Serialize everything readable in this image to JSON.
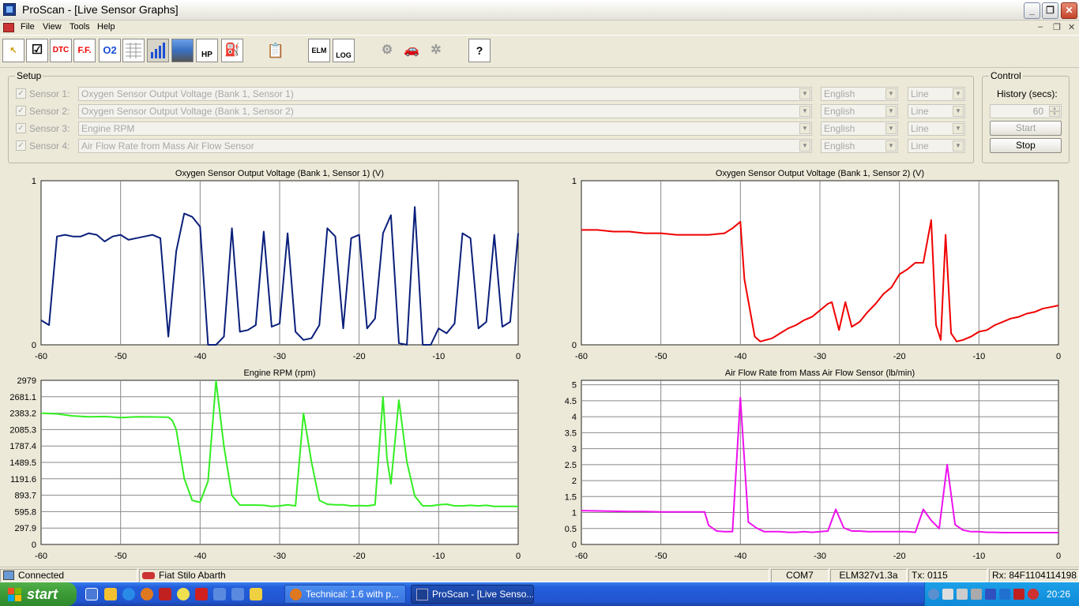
{
  "window": {
    "title": "ProScan - [Live Sensor Graphs]"
  },
  "menu": [
    "File",
    "View",
    "Tools",
    "Help"
  ],
  "toolbar": {
    "buttons": [
      "cursor",
      "checklist",
      "DTC",
      "F.F.",
      "O2",
      "table",
      "bar-graph",
      "road",
      "HP",
      "fuel",
      "clipboard",
      "ELM",
      "LOG",
      "engine",
      "car",
      "gear",
      "help"
    ],
    "labels": {
      "dtc": "DTC",
      "ff": "F.F.",
      "o2": "O2",
      "hp": "HP",
      "elm": "ELM",
      "log": "LOG",
      "help": "?"
    }
  },
  "setup": {
    "title": "Setup",
    "sensors": [
      {
        "label": "Sensor 1:",
        "pid": "Oxygen Sensor Output Voltage (Bank 1, Sensor 1)",
        "units": "English",
        "style": "Line"
      },
      {
        "label": "Sensor 2:",
        "pid": "Oxygen Sensor Output Voltage (Bank 1, Sensor 2)",
        "units": "English",
        "style": "Line"
      },
      {
        "label": "Sensor 3:",
        "pid": "Engine RPM",
        "units": "English",
        "style": "Line"
      },
      {
        "label": "Sensor 4:",
        "pid": "Air Flow Rate from Mass Air Flow Sensor",
        "units": "English",
        "style": "Line"
      }
    ]
  },
  "control": {
    "title": "Control",
    "history_label": "History (secs):",
    "history_value": "60",
    "start_label": "Start",
    "stop_label": "Stop"
  },
  "chart_data": [
    {
      "type": "line",
      "title": "Oxygen Sensor Output Voltage (Bank 1, Sensor 1) (V)",
      "color": "#0a1f7a",
      "x_ticks": [
        "-60",
        "-50",
        "-40",
        "-30",
        "-20",
        "-10",
        "0"
      ],
      "y_ticks": [
        "1",
        "0"
      ],
      "xlim": [
        -60,
        0
      ],
      "ylim": [
        0,
        1
      ],
      "x": [
        -60,
        -59,
        -58,
        -57,
        -56,
        -55,
        -54,
        -53,
        -52,
        -51,
        -50,
        -49,
        -48,
        -47,
        -46,
        -45,
        -44,
        -43,
        -42,
        -41,
        -40,
        -39,
        -38,
        -37,
        -36,
        -35,
        -34,
        -33,
        -32,
        -31,
        -30,
        -29,
        -28,
        -27,
        -26,
        -25,
        -24,
        -23,
        -22,
        -21,
        -20,
        -19,
        -18,
        -17,
        -16,
        -15,
        -14,
        -13,
        -12,
        -11,
        -10,
        -9,
        -8,
        -7,
        -6,
        -5,
        -4,
        -3,
        -2,
        -1,
        0
      ],
      "y": [
        0.15,
        0.12,
        0.66,
        0.67,
        0.66,
        0.66,
        0.68,
        0.67,
        0.63,
        0.66,
        0.67,
        0.64,
        0.65,
        0.66,
        0.67,
        0.65,
        0.05,
        0.57,
        0.8,
        0.78,
        0.72,
        0.0,
        0.0,
        0.05,
        0.71,
        0.08,
        0.09,
        0.12,
        0.69,
        0.11,
        0.13,
        0.68,
        0.08,
        0.03,
        0.04,
        0.12,
        0.71,
        0.66,
        0.1,
        0.65,
        0.67,
        0.1,
        0.16,
        0.68,
        0.79,
        0.01,
        0.0,
        0.84,
        0.0,
        0.0,
        0.1,
        0.07,
        0.13,
        0.68,
        0.65,
        0.1,
        0.14,
        0.67,
        0.11,
        0.14,
        0.68
      ]
    },
    {
      "type": "line",
      "title": "Oxygen Sensor Output Voltage (Bank 1, Sensor 2) (V)",
      "color": "#f00000",
      "x_ticks": [
        "-60",
        "-50",
        "-40",
        "-30",
        "-20",
        "-10",
        "0"
      ],
      "y_ticks": [
        "1",
        "0"
      ],
      "xlim": [
        -60,
        0
      ],
      "ylim": [
        0,
        1
      ],
      "x": [
        -60,
        -58,
        -56,
        -54,
        -52,
        -50,
        -48,
        -46,
        -44,
        -42,
        -41,
        -40,
        -39.5,
        -38.2,
        -37.5,
        -36,
        -35,
        -34,
        -33,
        -32,
        -31,
        -30,
        -29,
        -28.5,
        -27.6,
        -26.8,
        -26,
        -25,
        -24,
        -23,
        -22,
        -21,
        -20,
        -19,
        -18,
        -17,
        -16,
        -15.4,
        -14.8,
        -14.2,
        -13.5,
        -12.8,
        -12,
        -11,
        -10,
        -9,
        -8,
        -7,
        -6,
        -5,
        -4,
        -3,
        -2,
        -1,
        0
      ],
      "y": [
        0.7,
        0.7,
        0.69,
        0.69,
        0.68,
        0.68,
        0.67,
        0.67,
        0.67,
        0.68,
        0.71,
        0.75,
        0.4,
        0.05,
        0.02,
        0.04,
        0.07,
        0.1,
        0.12,
        0.15,
        0.17,
        0.21,
        0.25,
        0.26,
        0.09,
        0.26,
        0.11,
        0.14,
        0.2,
        0.25,
        0.31,
        0.35,
        0.43,
        0.46,
        0.5,
        0.5,
        0.76,
        0.12,
        0.03,
        0.67,
        0.07,
        0.02,
        0.03,
        0.05,
        0.08,
        0.09,
        0.12,
        0.14,
        0.16,
        0.17,
        0.19,
        0.2,
        0.22,
        0.23,
        0.24
      ]
    },
    {
      "type": "line",
      "title": "Engine RPM (rpm)",
      "color": "#33ee22",
      "x_ticks": [
        "-60",
        "-50",
        "-40",
        "-30",
        "-20",
        "-10",
        "0"
      ],
      "y_ticks": [
        "2979",
        "2681.1",
        "2383.2",
        "2085.3",
        "1787.4",
        "1489.5",
        "1191.6",
        "893.7",
        "595.8",
        "297.9",
        "0"
      ],
      "xlim": [
        -60,
        0
      ],
      "ylim": [
        0,
        2979
      ],
      "x": [
        -60,
        -58,
        -56,
        -54,
        -52,
        -50,
        -48,
        -46,
        -44,
        -43.5,
        -43,
        -42,
        -41,
        -40,
        -39,
        -38,
        -37,
        -36,
        -35,
        -34,
        -33,
        -32,
        -31,
        -30,
        -29,
        -28,
        -27,
        -26,
        -25,
        -24,
        -23,
        -22,
        -21,
        -20,
        -19,
        -18,
        -17,
        -16.5,
        -16,
        -15,
        -14,
        -13,
        -12,
        -11,
        -10,
        -9,
        -8,
        -7,
        -6,
        -5,
        -4,
        -3,
        -2,
        -1,
        0
      ],
      "y": [
        2383,
        2370,
        2333,
        2318,
        2321,
        2303,
        2316,
        2315,
        2310,
        2250,
        2085,
        1200,
        800,
        765,
        1150,
        2970,
        1780,
        890,
        715,
        715,
        715,
        710,
        690,
        700,
        720,
        700,
        2380,
        1500,
        800,
        730,
        720,
        720,
        700,
        705,
        700,
        720,
        2680,
        1560,
        1100,
        2620,
        1500,
        880,
        700,
        700,
        720,
        730,
        700,
        700,
        710,
        700,
        710,
        690,
        690,
        690,
        690
      ]
    },
    {
      "type": "line",
      "title": "Air Flow Rate from Mass Air Flow Sensor (lb/min)",
      "color": "#ee11ee",
      "x_ticks": [
        "-60",
        "-50",
        "-40",
        "-30",
        "-20",
        "-10",
        "0"
      ],
      "y_ticks": [
        "5",
        "4.5",
        "4",
        "3.5",
        "3",
        "2.5",
        "2",
        "1.5",
        "1",
        "0.5",
        "0"
      ],
      "xlim": [
        -60,
        0
      ],
      "ylim": [
        0,
        5.14
      ],
      "x": [
        -60,
        -58,
        -56,
        -54,
        -52,
        -50,
        -48,
        -46,
        -44.5,
        -44,
        -43,
        -42,
        -41,
        -40,
        -39,
        -38,
        -37,
        -36,
        -35,
        -34,
        -33,
        -32,
        -31,
        -30,
        -29,
        -28,
        -27,
        -26,
        -25,
        -24,
        -23,
        -22,
        -21,
        -20,
        -19,
        -18,
        -17,
        -16,
        -15,
        -14,
        -13,
        -12,
        -11,
        -10,
        -9,
        -8,
        -7,
        -6,
        -5,
        -4,
        -3,
        -2,
        -1,
        0
      ],
      "y": [
        1.06,
        1.05,
        1.04,
        1.03,
        1.03,
        1.02,
        1.02,
        1.02,
        1.02,
        0.6,
        0.42,
        0.4,
        0.4,
        4.6,
        0.7,
        0.52,
        0.4,
        0.4,
        0.4,
        0.38,
        0.38,
        0.4,
        0.38,
        0.4,
        0.42,
        1.1,
        0.52,
        0.42,
        0.42,
        0.4,
        0.4,
        0.4,
        0.4,
        0.4,
        0.4,
        0.38,
        1.1,
        0.75,
        0.5,
        2.5,
        0.62,
        0.45,
        0.4,
        0.4,
        0.38,
        0.38,
        0.37,
        0.37,
        0.37,
        0.37,
        0.37,
        0.37,
        0.37,
        0.37
      ]
    }
  ],
  "status": {
    "connected": "Connected",
    "vehicle": "Fiat Stilo Abarth",
    "port": "COM7",
    "device": "ELM327v1.3a",
    "tx": "Tx: 0115",
    "rx": "Rx: 84F1104114198"
  },
  "taskbar": {
    "start_label": "start",
    "tasks": [
      {
        "label": "Technical: 1.6 with p...",
        "active": false
      },
      {
        "label": "ProScan - [Live Senso...",
        "active": true
      }
    ],
    "clock": "20:26"
  }
}
